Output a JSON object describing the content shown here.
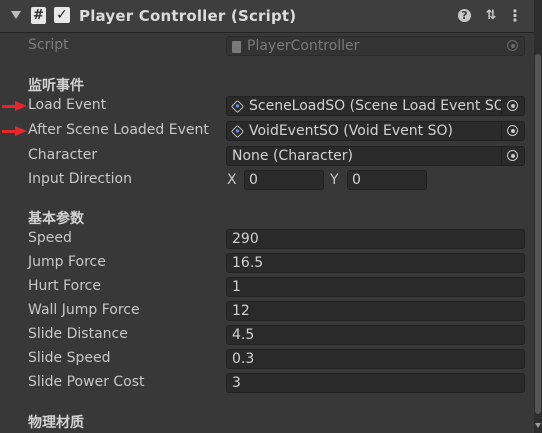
{
  "component": {
    "title": "Player Controller (Script)",
    "enabled_check": "✓",
    "script_icon": "#",
    "icons": [
      "fold-arrow-icon",
      "script-icon",
      "help-icon",
      "preset-icon",
      "context-menu-icon"
    ]
  },
  "colors": {
    "arrow": "#e8262a",
    "background": "#383838",
    "field": "#2a2a2a"
  },
  "script": {
    "label": "Script",
    "value": "PlayerController"
  },
  "events": {
    "section_title": "监听事件",
    "load_event": {
      "label": "Load Event",
      "value": "SceneLoadSO (Scene Load Event SO)"
    },
    "after_scene_loaded_event": {
      "label": "After Scene Loaded Event",
      "value": "VoidEventSO (Void Event SO)"
    },
    "character": {
      "label": "Character",
      "value": "None (Character)"
    },
    "input_direction": {
      "label": "Input Direction",
      "x_label": "X",
      "x": "0",
      "y_label": "Y",
      "y": "0"
    }
  },
  "basic": {
    "section_title": "基本参数",
    "fields": [
      {
        "label": "Speed",
        "value": "290"
      },
      {
        "label": "Jump Force",
        "value": "16.5"
      },
      {
        "label": "Hurt Force",
        "value": "1"
      },
      {
        "label": "Wall Jump Force",
        "value": "12"
      },
      {
        "label": "Slide Distance",
        "value": "4.5"
      },
      {
        "label": "Slide Speed",
        "value": "0.3"
      },
      {
        "label": "Slide Power Cost",
        "value": "3"
      }
    ]
  },
  "physics": {
    "section_title": "物理材质"
  }
}
